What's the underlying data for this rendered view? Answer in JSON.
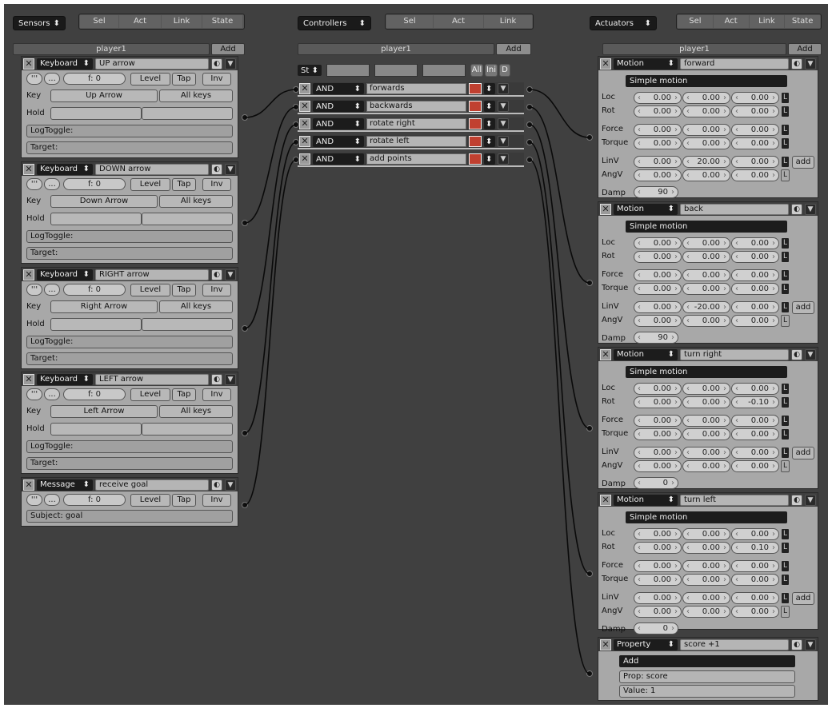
{
  "header": {
    "sensors_dd": "Sensors",
    "controllers_dd": "Controllers",
    "actuators_dd": "Actuators",
    "sel": "Sel",
    "act": "Act",
    "link": "Link",
    "state": "State"
  },
  "object_name": "player1",
  "add_label": "Add",
  "sensors": [
    {
      "type": "Keyboard",
      "name": "UP arrow",
      "key": "Up Arrow",
      "all_keys": "All keys"
    },
    {
      "type": "Keyboard",
      "name": "DOWN arrow",
      "key": "Down Arrow",
      "all_keys": "All keys"
    },
    {
      "type": "Keyboard",
      "name": "RIGHT arrow",
      "key": "Right Arrow",
      "all_keys": "All keys"
    },
    {
      "type": "Keyboard",
      "name": "LEFT arrow",
      "key": "Left Arrow",
      "all_keys": "All keys"
    }
  ],
  "message_sensor": {
    "type": "Message",
    "name": "receive goal",
    "subject": "Subject: goal"
  },
  "sensor_common": {
    "pulse_a": "'''",
    "pulse_b": "...",
    "freq": "f: 0",
    "level": "Level",
    "tap": "Tap",
    "inv": "Inv",
    "key_lbl": "Key",
    "hold_lbl": "Hold",
    "logtoggle": "LogToggle:",
    "target": "Target:"
  },
  "controllers_bar": {
    "st": "St",
    "all": "All",
    "ini": "Ini",
    "d": "D"
  },
  "controllers": [
    {
      "type": "AND",
      "name": "forwards"
    },
    {
      "type": "AND",
      "name": "backwards"
    },
    {
      "type": "AND",
      "name": "rotate right"
    },
    {
      "type": "AND",
      "name": "rotate left"
    },
    {
      "type": "AND",
      "name": "add points"
    }
  ],
  "motion_labels": {
    "simple": "Simple motion",
    "loc": "Loc",
    "rot": "Rot",
    "force": "Force",
    "torque": "Torque",
    "linv": "LinV",
    "angv": "AngV",
    "damp": "Damp",
    "add": "add",
    "l": "L"
  },
  "actuators": [
    {
      "type": "Motion",
      "name": "forward",
      "loc": [
        "0.00",
        "0.00",
        "0.00"
      ],
      "rot": [
        "0.00",
        "0.00",
        "0.00"
      ],
      "force": [
        "0.00",
        "0.00",
        "0.00"
      ],
      "torque": [
        "0.00",
        "0.00",
        "0.00"
      ],
      "linv": [
        "0.00",
        "20.00",
        "0.00"
      ],
      "angv": [
        "0.00",
        "0.00",
        "0.00"
      ],
      "damp": "90"
    },
    {
      "type": "Motion",
      "name": "back",
      "loc": [
        "0.00",
        "0.00",
        "0.00"
      ],
      "rot": [
        "0.00",
        "0.00",
        "0.00"
      ],
      "force": [
        "0.00",
        "0.00",
        "0.00"
      ],
      "torque": [
        "0.00",
        "0.00",
        "0.00"
      ],
      "linv": [
        "0.00",
        "-20.00",
        "0.00"
      ],
      "angv": [
        "0.00",
        "0.00",
        "0.00"
      ],
      "damp": "90"
    },
    {
      "type": "Motion",
      "name": "turn right",
      "loc": [
        "0.00",
        "0.00",
        "0.00"
      ],
      "rot": [
        "0.00",
        "0.00",
        "-0.10"
      ],
      "force": [
        "0.00",
        "0.00",
        "0.00"
      ],
      "torque": [
        "0.00",
        "0.00",
        "0.00"
      ],
      "linv": [
        "0.00",
        "0.00",
        "0.00"
      ],
      "angv": [
        "0.00",
        "0.00",
        "0.00"
      ],
      "damp": "0"
    },
    {
      "type": "Motion",
      "name": "turn left",
      "loc": [
        "0.00",
        "0.00",
        "0.00"
      ],
      "rot": [
        "0.00",
        "0.00",
        "0.10"
      ],
      "force": [
        "0.00",
        "0.00",
        "0.00"
      ],
      "torque": [
        "0.00",
        "0.00",
        "0.00"
      ],
      "linv": [
        "0.00",
        "0.00",
        "0.00"
      ],
      "angv": [
        "0.00",
        "0.00",
        "0.00"
      ],
      "damp": "0"
    }
  ],
  "property_actuator": {
    "type": "Property",
    "name": "score +1",
    "mode": "Add",
    "prop": "Prop: score",
    "value": "Value: 1"
  }
}
